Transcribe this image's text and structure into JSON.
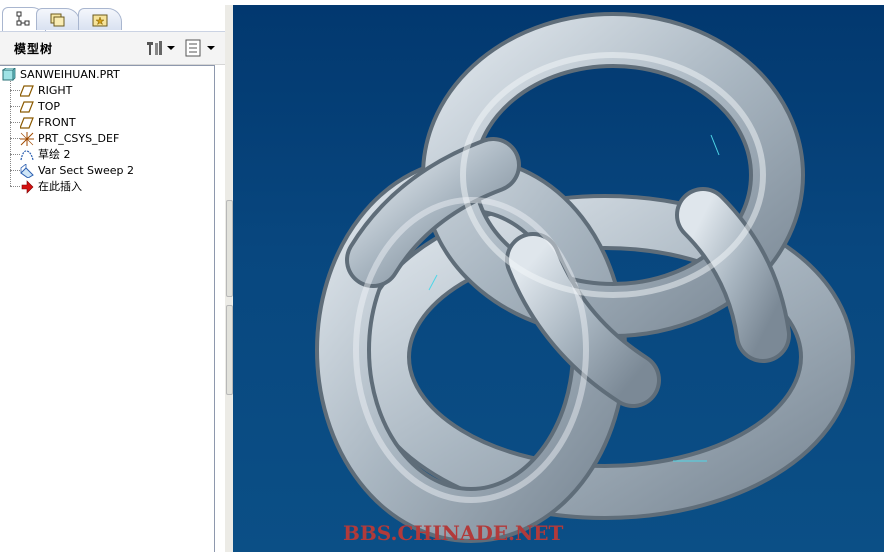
{
  "navigator": {
    "tabs": [
      {
        "name": "model-tree-tab",
        "icon": "model-tree-icon",
        "active": true
      },
      {
        "name": "folder-browser-tab",
        "icon": "folder-browser-icon",
        "active": false
      },
      {
        "name": "favorites-tab",
        "icon": "favorites-icon",
        "active": false
      }
    ],
    "tree_title": "模型树",
    "tools_icon": "tree-settings-icon",
    "show_icon": "tree-show-icon"
  },
  "model_tree": {
    "items": [
      {
        "label": "SANWEIHUAN.PRT",
        "icon": "part-icon"
      },
      {
        "label": "RIGHT",
        "icon": "datum-plane-icon"
      },
      {
        "label": "TOP",
        "icon": "datum-plane-icon"
      },
      {
        "label": "FRONT",
        "icon": "datum-plane-icon"
      },
      {
        "label": "PRT_CSYS_DEF",
        "icon": "coordinate-system-icon"
      },
      {
        "label": "草绘 2",
        "icon": "sketch-icon"
      },
      {
        "label": "Var Sect Sweep 2",
        "icon": "sweep-icon"
      },
      {
        "label": "在此插入",
        "icon": "insert-here-arrow-icon"
      }
    ]
  },
  "viewport": {
    "model": "trefoil-knot",
    "background_top": "#02386f",
    "background_bottom": "#0b4f86",
    "model_color": "#a9b6c1",
    "watermark": "BBS.CHINADE.NET"
  }
}
